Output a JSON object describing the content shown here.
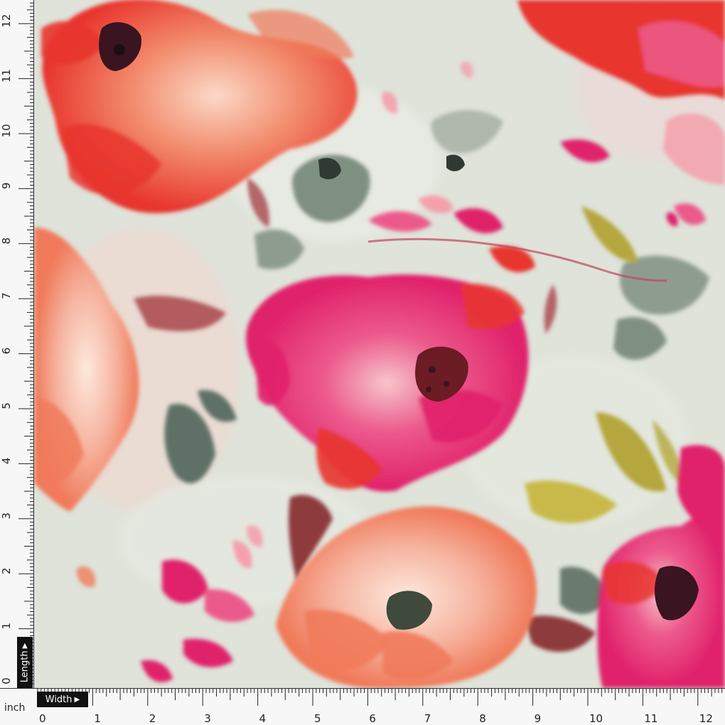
{
  "ruler": {
    "unit": "inch",
    "length_label": "Length",
    "width_label": "Width",
    "arrow_glyph": "▶",
    "length_ticks": [
      "0",
      "1",
      "2",
      "3",
      "4",
      "5",
      "6",
      "7",
      "8",
      "9",
      "10",
      "11",
      "12"
    ],
    "width_ticks": [
      "0",
      "1",
      "2",
      "3",
      "4",
      "5",
      "6",
      "7",
      "8",
      "9",
      "10",
      "11",
      "12"
    ]
  },
  "colors": {
    "background": "#dfe3da",
    "red": "#e8352e",
    "coral": "#f07a5a",
    "pink": "#e83c7a",
    "magenta": "#e0206a",
    "peach": "#f6b4a0",
    "sage": "#7f8f82",
    "olive": "#b5a63c",
    "maroon": "#6b1c24"
  }
}
